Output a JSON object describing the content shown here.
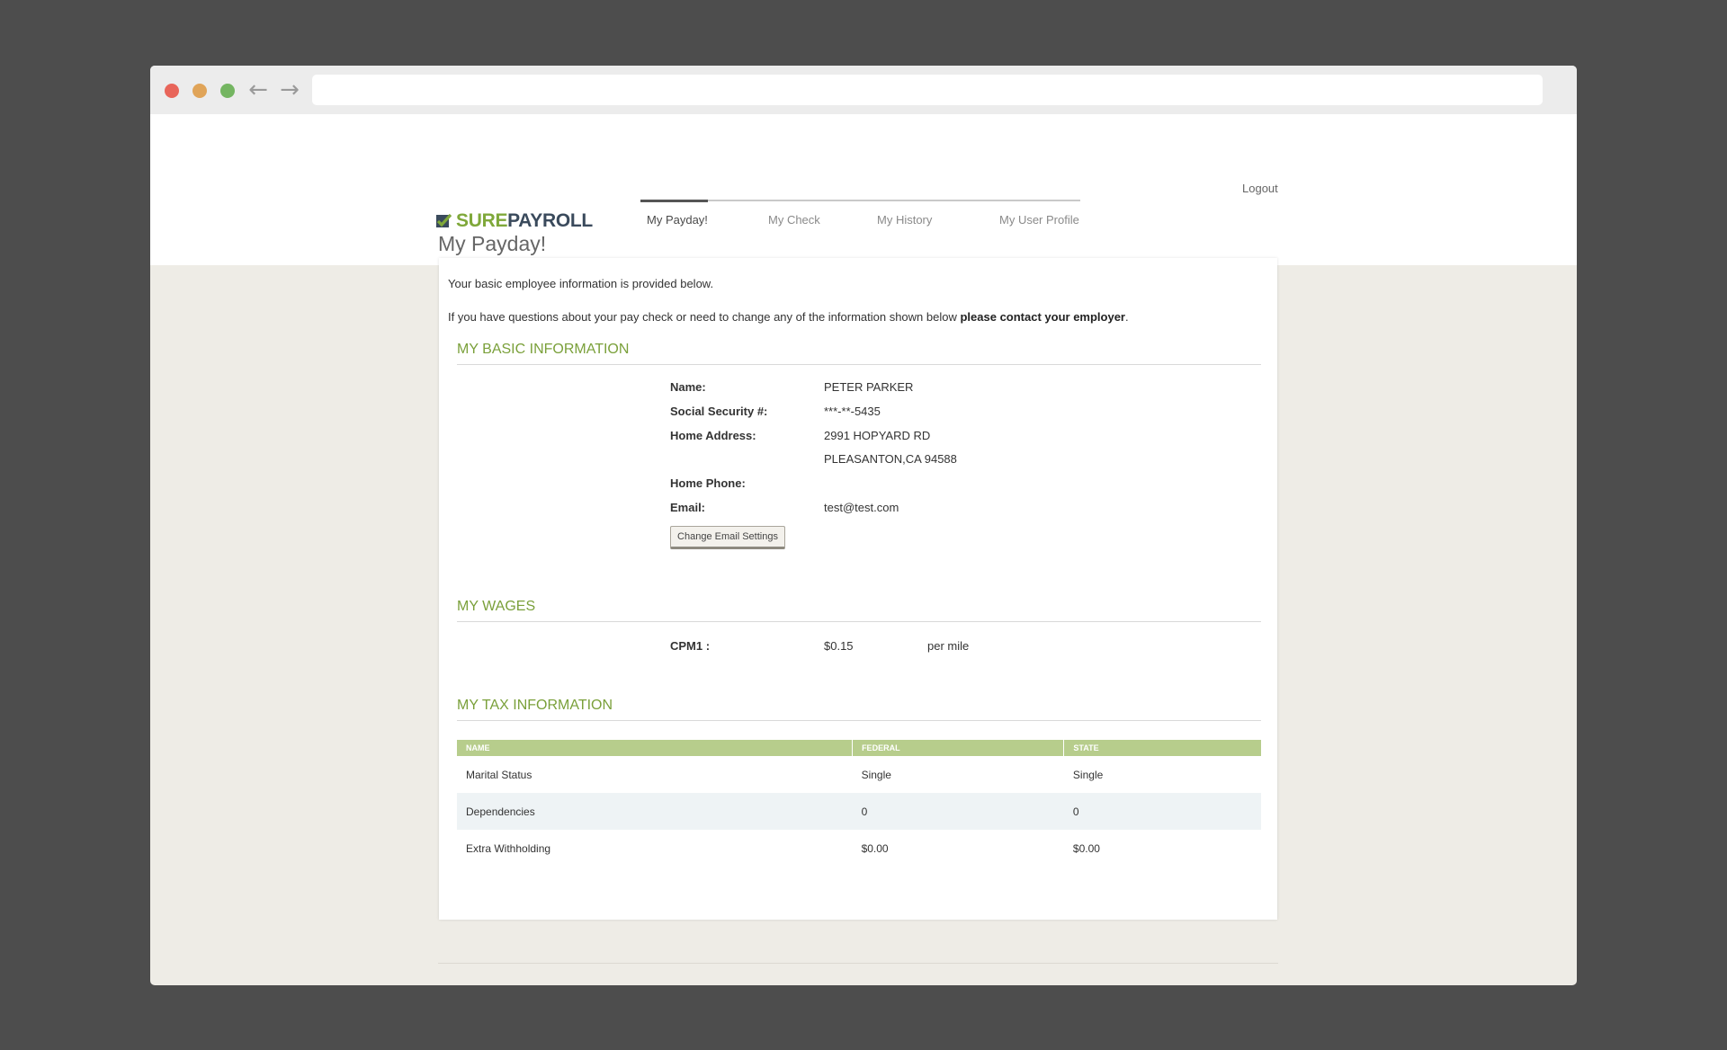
{
  "header": {
    "logout": "Logout",
    "logo": {
      "sure": "SURE",
      "payroll": "PAYROLL"
    },
    "tabs": [
      {
        "label": "My Payday!",
        "active": true
      },
      {
        "label": "My Check",
        "active": false
      },
      {
        "label": "My History",
        "active": false
      },
      {
        "label": "My User Profile",
        "active": false
      }
    ]
  },
  "page": {
    "title": "My Payday!",
    "intro_line1": "Your basic employee information is provided below.",
    "intro_line2_prefix": "If you have questions about your pay check or need to change any of the information shown below ",
    "intro_line2_bold": "please contact your employer",
    "intro_line2_suffix": "."
  },
  "basic_info": {
    "title": "MY BASIC INFORMATION",
    "fields": {
      "name": {
        "label": "Name:",
        "value": "PETER PARKER"
      },
      "ssn": {
        "label": "Social Security #:",
        "value": "***-**-5435"
      },
      "address": {
        "label": "Home Address:",
        "line1": "2991 HOPYARD RD",
        "line2": "PLEASANTON,CA 94588"
      },
      "phone": {
        "label": "Home Phone:",
        "value": ""
      },
      "email": {
        "label": "Email:",
        "value": "test@test.com"
      }
    },
    "change_email_button": "Change Email Settings"
  },
  "wages": {
    "title": "MY WAGES",
    "label": "CPM1 :",
    "value": "$0.15",
    "unit": "per mile"
  },
  "tax_info": {
    "title": "MY TAX INFORMATION",
    "columns": [
      "NAME",
      "FEDERAL",
      "STATE"
    ],
    "rows": [
      {
        "name": "Marital Status",
        "federal": "Single",
        "state": "Single"
      },
      {
        "name": "Dependencies",
        "federal": "0",
        "state": "0"
      },
      {
        "name": "Extra Withholding",
        "federal": "$0.00",
        "state": "$0.00"
      }
    ]
  },
  "colors": {
    "accent_green": "#7aa03a",
    "table_header": "#b7cd8c",
    "page_bg": "#eeece6"
  }
}
